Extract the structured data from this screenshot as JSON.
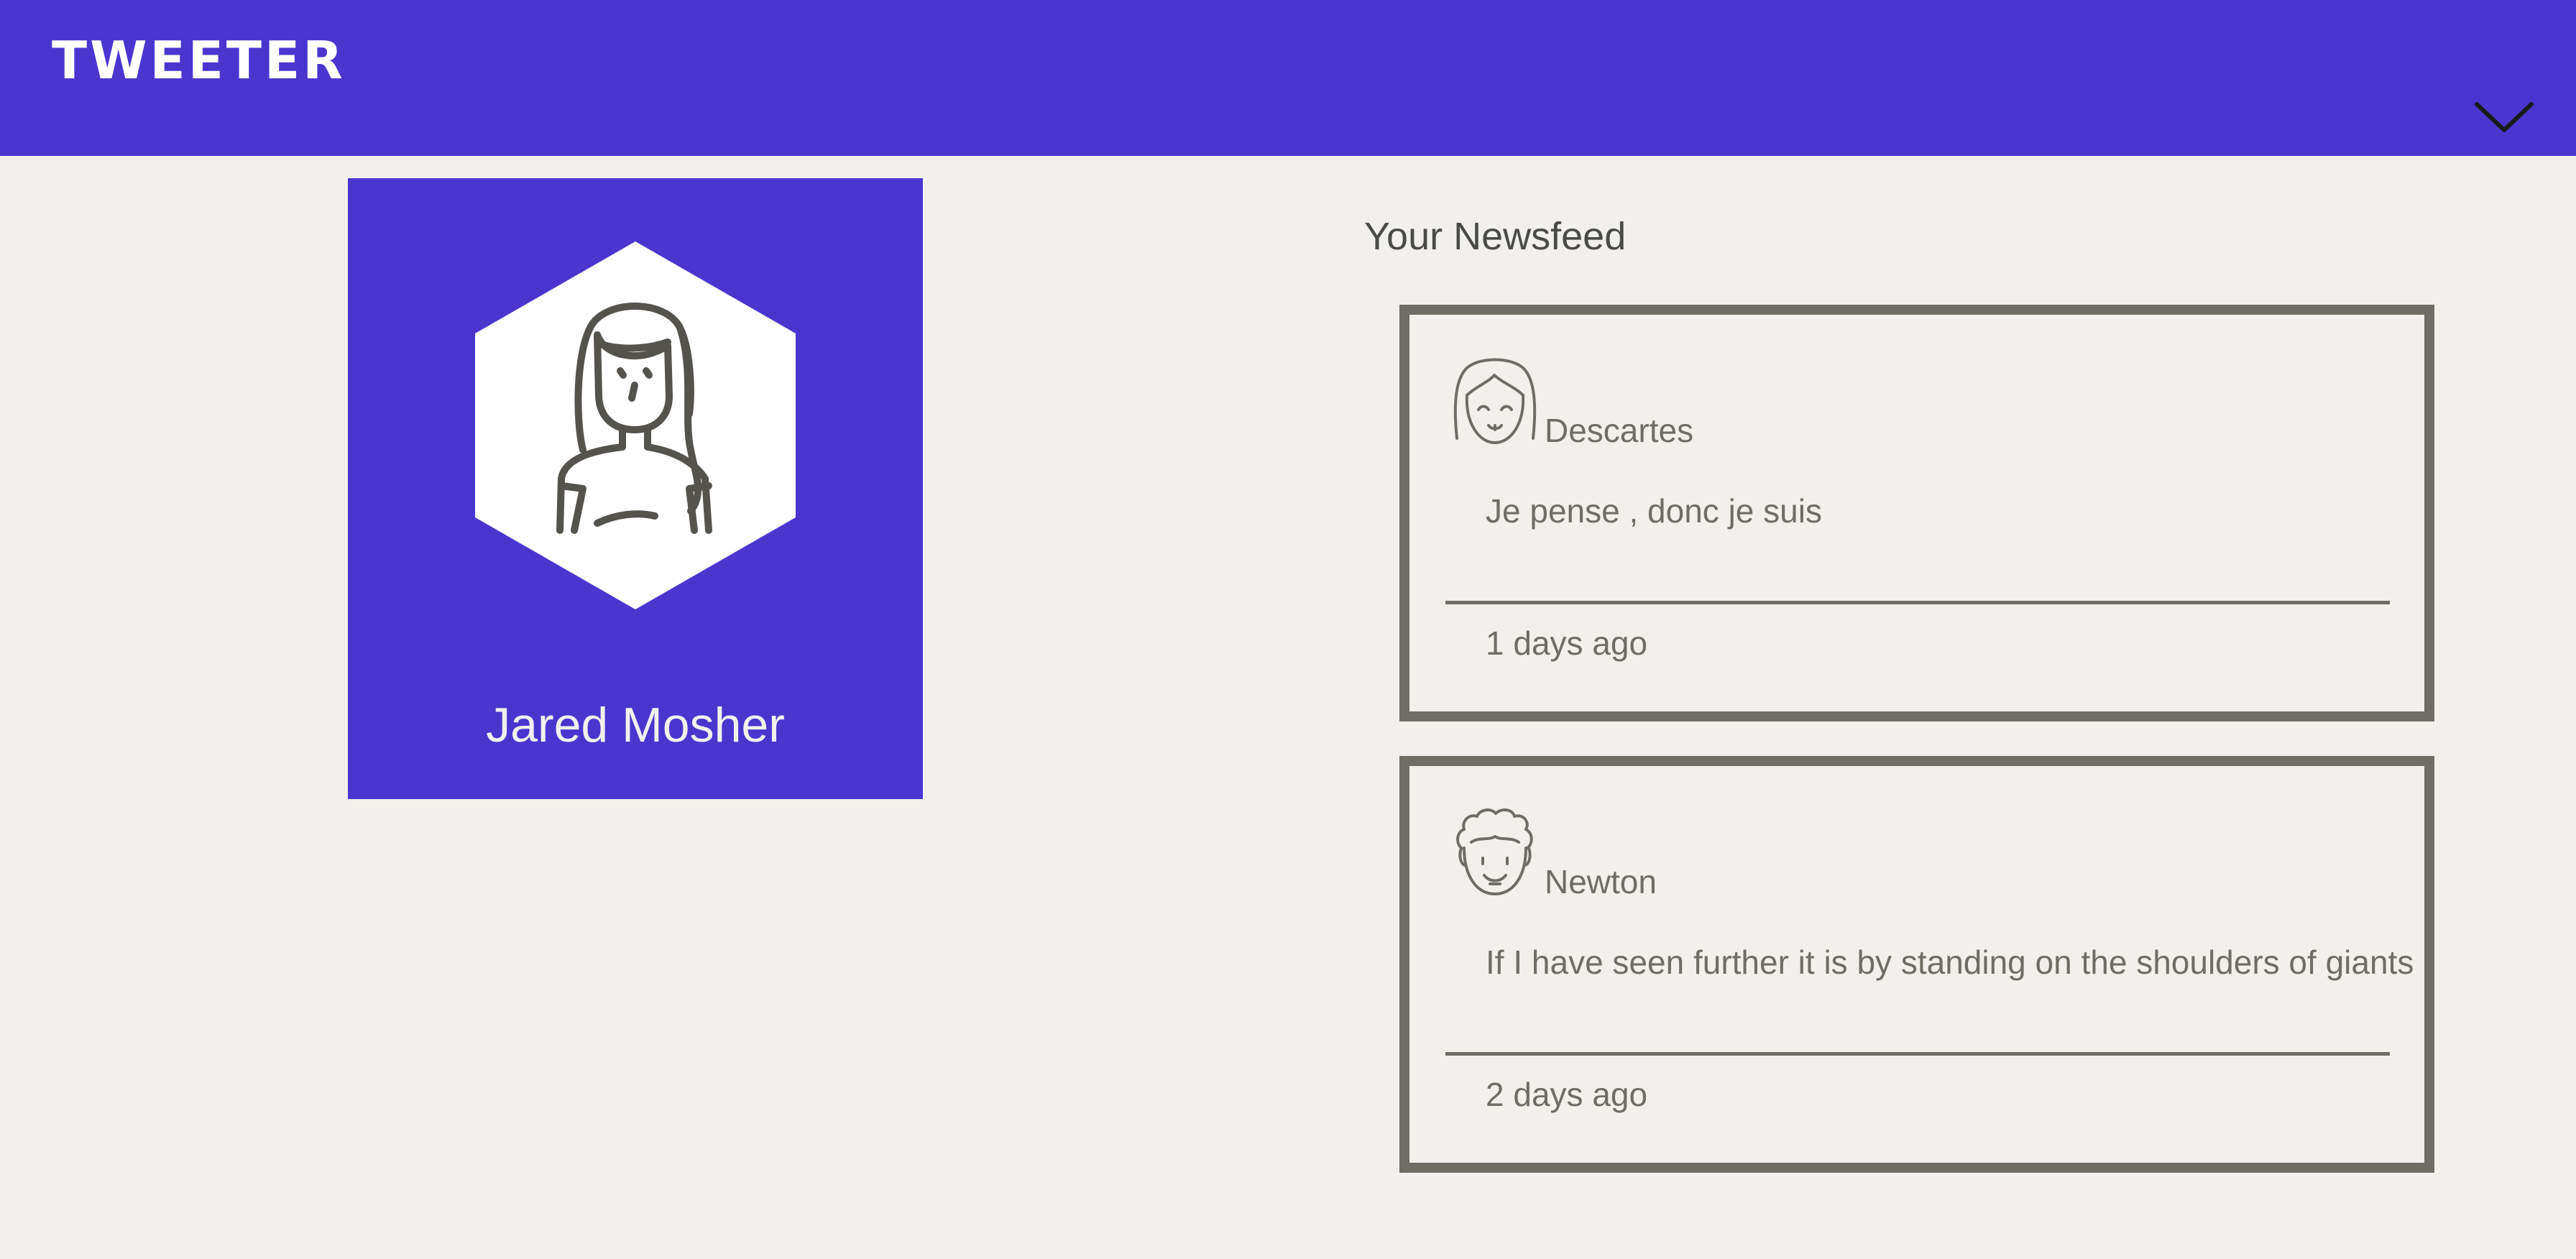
{
  "header": {
    "logo_text": "TWEETER",
    "menu_icon": "chevron-down-icon",
    "background_color": "#4a36cf"
  },
  "profile": {
    "name": "Jared Mosher",
    "avatar_icon": "woman-avatar-icon"
  },
  "newsfeed": {
    "title": "Your Newsfeed",
    "posts": [
      {
        "author": "Descartes",
        "avatar_icon": "girl-with-bangs-avatar-icon",
        "text": "Je pense , donc je suis",
        "time": "1 days ago"
      },
      {
        "author": "Newton",
        "avatar_icon": "curly-hair-avatar-icon",
        "text": "If I have seen further it is by standing on the shoulders of giants",
        "time": "2 days ago"
      }
    ]
  },
  "colors": {
    "accent": "#4a36cf",
    "page_background": "#f1f0ec",
    "card_border": "#6e6d66"
  }
}
